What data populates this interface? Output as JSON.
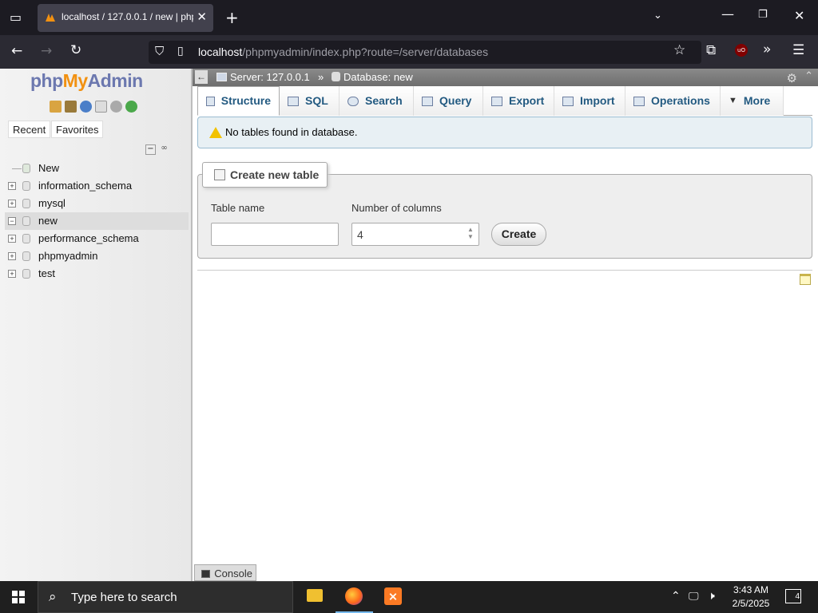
{
  "browser": {
    "tab_title": "localhost / 127.0.0.1 / new | php",
    "url_host": "localhost",
    "url_path": "/phpmyadmin/index.php?route=/server/databases"
  },
  "logo": {
    "part1": "php",
    "part2": "My",
    "part3": "Admin"
  },
  "leftnav": {
    "tabs": [
      "Recent",
      "Favorites"
    ],
    "tree": [
      {
        "label": "New",
        "active": false
      },
      {
        "label": "information_schema",
        "active": false
      },
      {
        "label": "mysql",
        "active": false
      },
      {
        "label": "new",
        "active": true
      },
      {
        "label": "performance_schema",
        "active": false
      },
      {
        "label": "phpmyadmin",
        "active": false
      },
      {
        "label": "test",
        "active": false
      }
    ]
  },
  "breadcrumb": {
    "server_label": "Server:",
    "server_value": "127.0.0.1",
    "separator": "»",
    "db_label": "Database:",
    "db_value": "new"
  },
  "menu": {
    "tabs": [
      "Structure",
      "SQL",
      "Search",
      "Query",
      "Export",
      "Import",
      "Operations",
      "More"
    ]
  },
  "alert": {
    "text": "No tables found in database."
  },
  "create_table": {
    "legend": "Create new table",
    "table_name_label": "Table name",
    "table_name_value": "",
    "columns_label": "Number of columns",
    "columns_value": "4",
    "create_button": "Create"
  },
  "console": {
    "label": "Console"
  },
  "taskbar": {
    "search_placeholder": "Type here to search",
    "time": "3:43 AM",
    "date": "2/5/2025",
    "notifications": "4"
  }
}
